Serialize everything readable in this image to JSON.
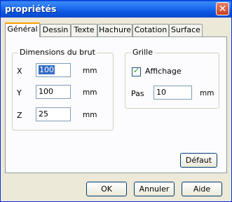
{
  "window": {
    "title": "propriétés",
    "close_glyph": "✕"
  },
  "tabs": [
    {
      "label": "Général",
      "active": true
    },
    {
      "label": "Dessin"
    },
    {
      "label": "Texte"
    },
    {
      "label": "Hachure"
    },
    {
      "label": "Cotation"
    },
    {
      "label": "Surface"
    }
  ],
  "dimensions": {
    "legend": "Dimensions du brut",
    "x": {
      "label": "X",
      "value": "100",
      "unit": "mm"
    },
    "y": {
      "label": "Y",
      "value": "100",
      "unit": "mm"
    },
    "z": {
      "label": "Z",
      "value": "25",
      "unit": "mm"
    }
  },
  "grille": {
    "legend": "Grille",
    "affichage": {
      "label": "Affichage",
      "checked": true
    },
    "pas": {
      "label": "Pas",
      "value": "10",
      "unit": "mm"
    }
  },
  "buttons": {
    "defaut": "Défaut",
    "ok": "OK",
    "annuler": "Annuler",
    "aide": "Aide"
  },
  "colors": {
    "titlebar": "#0a5fe0",
    "selection": "#316ac5",
    "active_tab_accent": "#ff9d00"
  }
}
